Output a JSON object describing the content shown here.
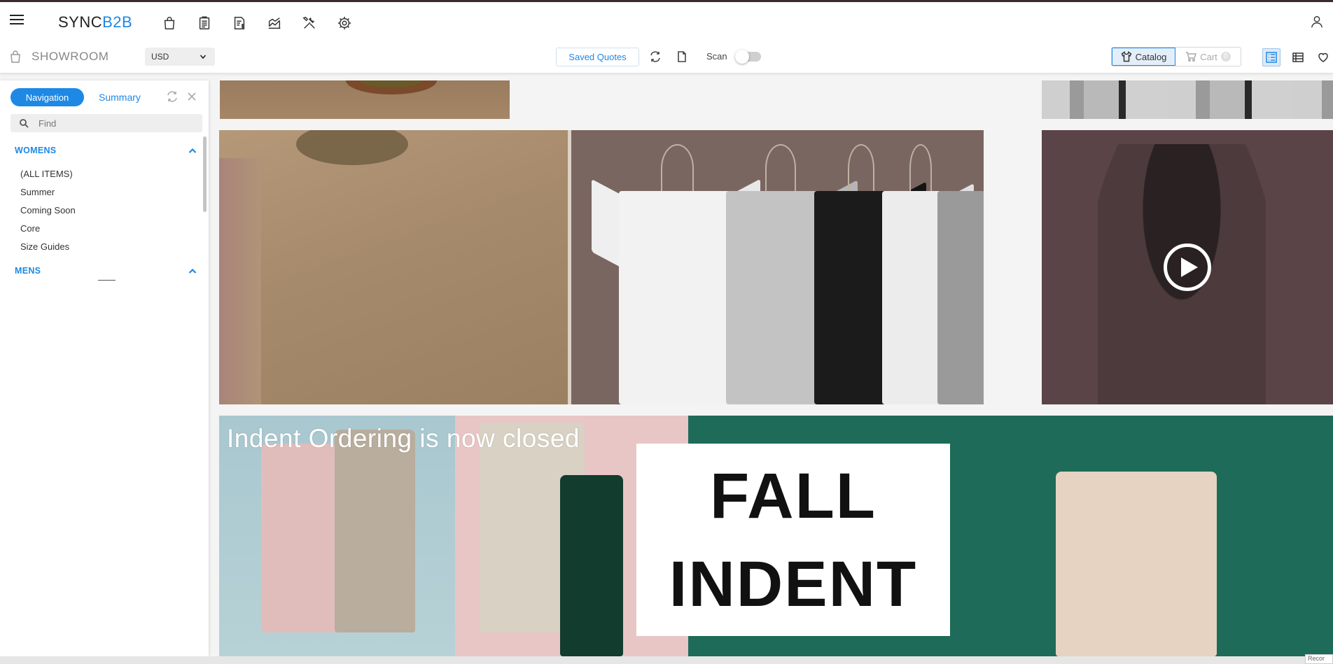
{
  "app": {
    "logo_part1": "SYNC",
    "logo_part2": "B2B",
    "accent_color": "#1e88e5"
  },
  "top_icons": [
    "bag-icon",
    "clipboard-icon",
    "invoice-icon",
    "chart-icon",
    "tools-icon",
    "settings-icon",
    "user-icon"
  ],
  "subbar": {
    "showroom_label": "SHOWROOM",
    "currency": "USD",
    "saved_quotes_label": "Saved Quotes",
    "scan_label": "Scan",
    "scan_enabled": false,
    "catalog_label": "Catalog",
    "cart_label": "Cart",
    "cart_count": "0"
  },
  "sidebar": {
    "tab_navigation": "Navigation",
    "tab_summary": "Summary",
    "find_placeholder": "Find",
    "sections": [
      {
        "title": "WOMENS",
        "expanded": true,
        "items": [
          "(ALL ITEMS)",
          "Summer",
          "Coming Soon",
          "Core",
          "Size Guides"
        ]
      },
      {
        "title": "MENS",
        "expanded": true,
        "items": []
      }
    ]
  },
  "banners": {
    "fall_line1": "FALL",
    "fall_line2": "INDENT",
    "closed_notice": "Indent Ordering is now closed"
  },
  "footer": {
    "corner_text": "Recor"
  }
}
